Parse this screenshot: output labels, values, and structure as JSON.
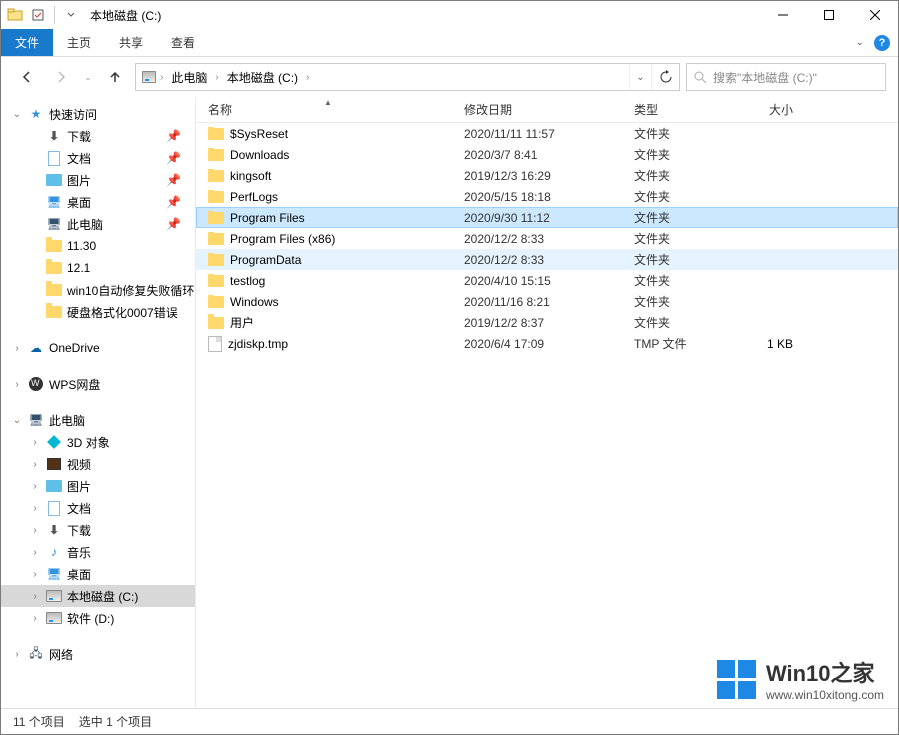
{
  "title": "本地磁盘 (C:)",
  "ribbon": {
    "file": "文件",
    "home": "主页",
    "share": "共享",
    "view": "查看"
  },
  "breadcrumbs": {
    "root": "此电脑",
    "drive": "本地磁盘 (C:)"
  },
  "search_placeholder": "搜索\"本地磁盘 (C:)\"",
  "columns": {
    "name": "名称",
    "date": "修改日期",
    "type": "类型",
    "size": "大小"
  },
  "nav": {
    "quick": "快速访问",
    "downloads": "下载",
    "docs": "文档",
    "pictures": "图片",
    "desktop": "桌面",
    "thispc": "此电脑",
    "f1": "11.30",
    "f2": "12.1",
    "f3": "win10自动修复失败循环",
    "f4": "硬盘格式化0007错误",
    "onedrive": "OneDrive",
    "wps": "WPS网盘",
    "thispc2": "此电脑",
    "obj3d": "3D 对象",
    "video": "视频",
    "pictures2": "图片",
    "docs2": "文档",
    "downloads2": "下载",
    "music": "音乐",
    "desktop2": "桌面",
    "driveC": "本地磁盘 (C:)",
    "driveD": "软件 (D:)",
    "network": "网络"
  },
  "rows": [
    {
      "name": "$SysReset",
      "date": "2020/11/11 11:57",
      "type": "文件夹",
      "size": "",
      "icon": "folder"
    },
    {
      "name": "Downloads",
      "date": "2020/3/7 8:41",
      "type": "文件夹",
      "size": "",
      "icon": "folder"
    },
    {
      "name": "kingsoft",
      "date": "2019/12/3 16:29",
      "type": "文件夹",
      "size": "",
      "icon": "folder"
    },
    {
      "name": "PerfLogs",
      "date": "2020/5/15 18:18",
      "type": "文件夹",
      "size": "",
      "icon": "folder"
    },
    {
      "name": "Program Files",
      "date": "2020/9/30 11:12",
      "type": "文件夹",
      "size": "",
      "icon": "folder",
      "state": "selected"
    },
    {
      "name": "Program Files (x86)",
      "date": "2020/12/2 8:33",
      "type": "文件夹",
      "size": "",
      "icon": "folder"
    },
    {
      "name": "ProgramData",
      "date": "2020/12/2 8:33",
      "type": "文件夹",
      "size": "",
      "icon": "folder",
      "state": "hover"
    },
    {
      "name": "testlog",
      "date": "2020/4/10 15:15",
      "type": "文件夹",
      "size": "",
      "icon": "folder"
    },
    {
      "name": "Windows",
      "date": "2020/11/16 8:21",
      "type": "文件夹",
      "size": "",
      "icon": "folder"
    },
    {
      "name": "用户",
      "date": "2019/12/2 8:37",
      "type": "文件夹",
      "size": "",
      "icon": "folder"
    },
    {
      "name": "zjdiskp.tmp",
      "date": "2020/6/4 17:09",
      "type": "TMP 文件",
      "size": "1 KB",
      "icon": "file"
    }
  ],
  "status": {
    "count": "11 个项目",
    "selected": "选中 1 个项目"
  },
  "watermark": {
    "title": "Win10之家",
    "sub": "www.win10xitong.com"
  }
}
